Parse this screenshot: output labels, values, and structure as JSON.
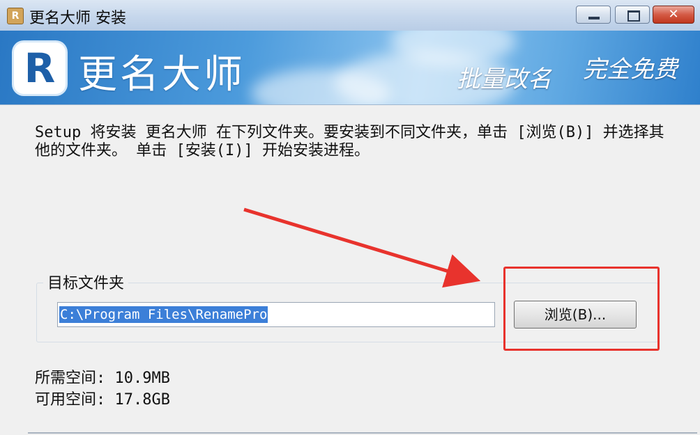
{
  "window": {
    "title": "更名大师 安装",
    "app_icon_letter": "R"
  },
  "banner": {
    "title": "更名大师",
    "logo_letter": "R",
    "slogan_1": "批量改名",
    "slogan_2": "完全免费"
  },
  "body": {
    "description": "Setup 将安装 更名大师 在下列文件夹。要安装到不同文件夹，单击 [浏览(B)] 并选择其他的文件夹。 单击 [安装(I)] 开始安装进程。",
    "destination_group_label": "目标文件夹",
    "install_path": "C:\\Program Files\\RenamePro",
    "browse_label": "浏览(B)...",
    "space_required": "所需空间: 10.9MB",
    "space_available": "可用空间: 17.8GB"
  },
  "colors": {
    "annotation_red": "#e8332d",
    "selection_blue": "#3c7fd8"
  }
}
